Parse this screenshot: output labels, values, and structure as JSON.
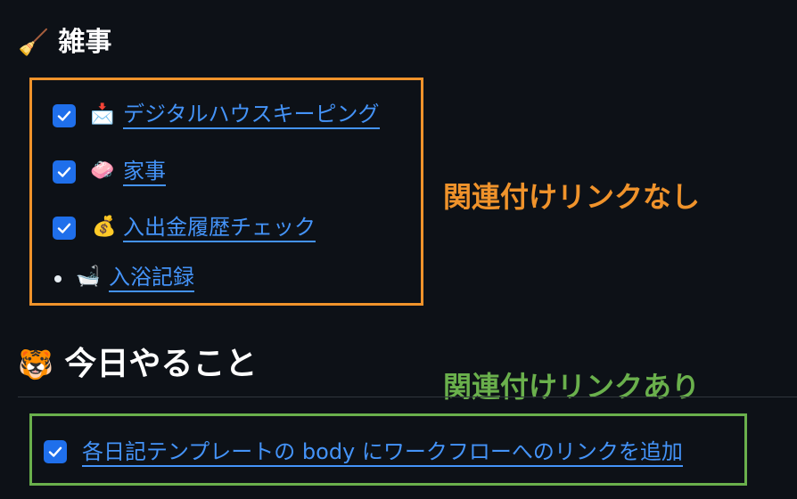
{
  "chores_section": {
    "emoji": "🧹",
    "title": "雑事",
    "items": [
      {
        "checked": true,
        "emoji": "📩",
        "label": "デジタルハウスキーピング"
      },
      {
        "checked": true,
        "emoji": "🧼",
        "label": "家事"
      },
      {
        "checked": true,
        "emoji": "💰",
        "label": "入出金履歴チェック"
      },
      {
        "checked": false,
        "emoji": "🛁",
        "label": "入浴記録"
      }
    ]
  },
  "today_section": {
    "emoji": "🐯",
    "title": "今日やること",
    "items": [
      {
        "checked": true,
        "label": "各日記テンプレートの body にワークフローへのリンクを追加"
      }
    ]
  },
  "annotations": {
    "no_link": {
      "text": "関連付けリンクなし",
      "color": "#f0932b"
    },
    "with_link": {
      "text": "関連付けリンクあり",
      "color": "#6ab04c"
    }
  }
}
